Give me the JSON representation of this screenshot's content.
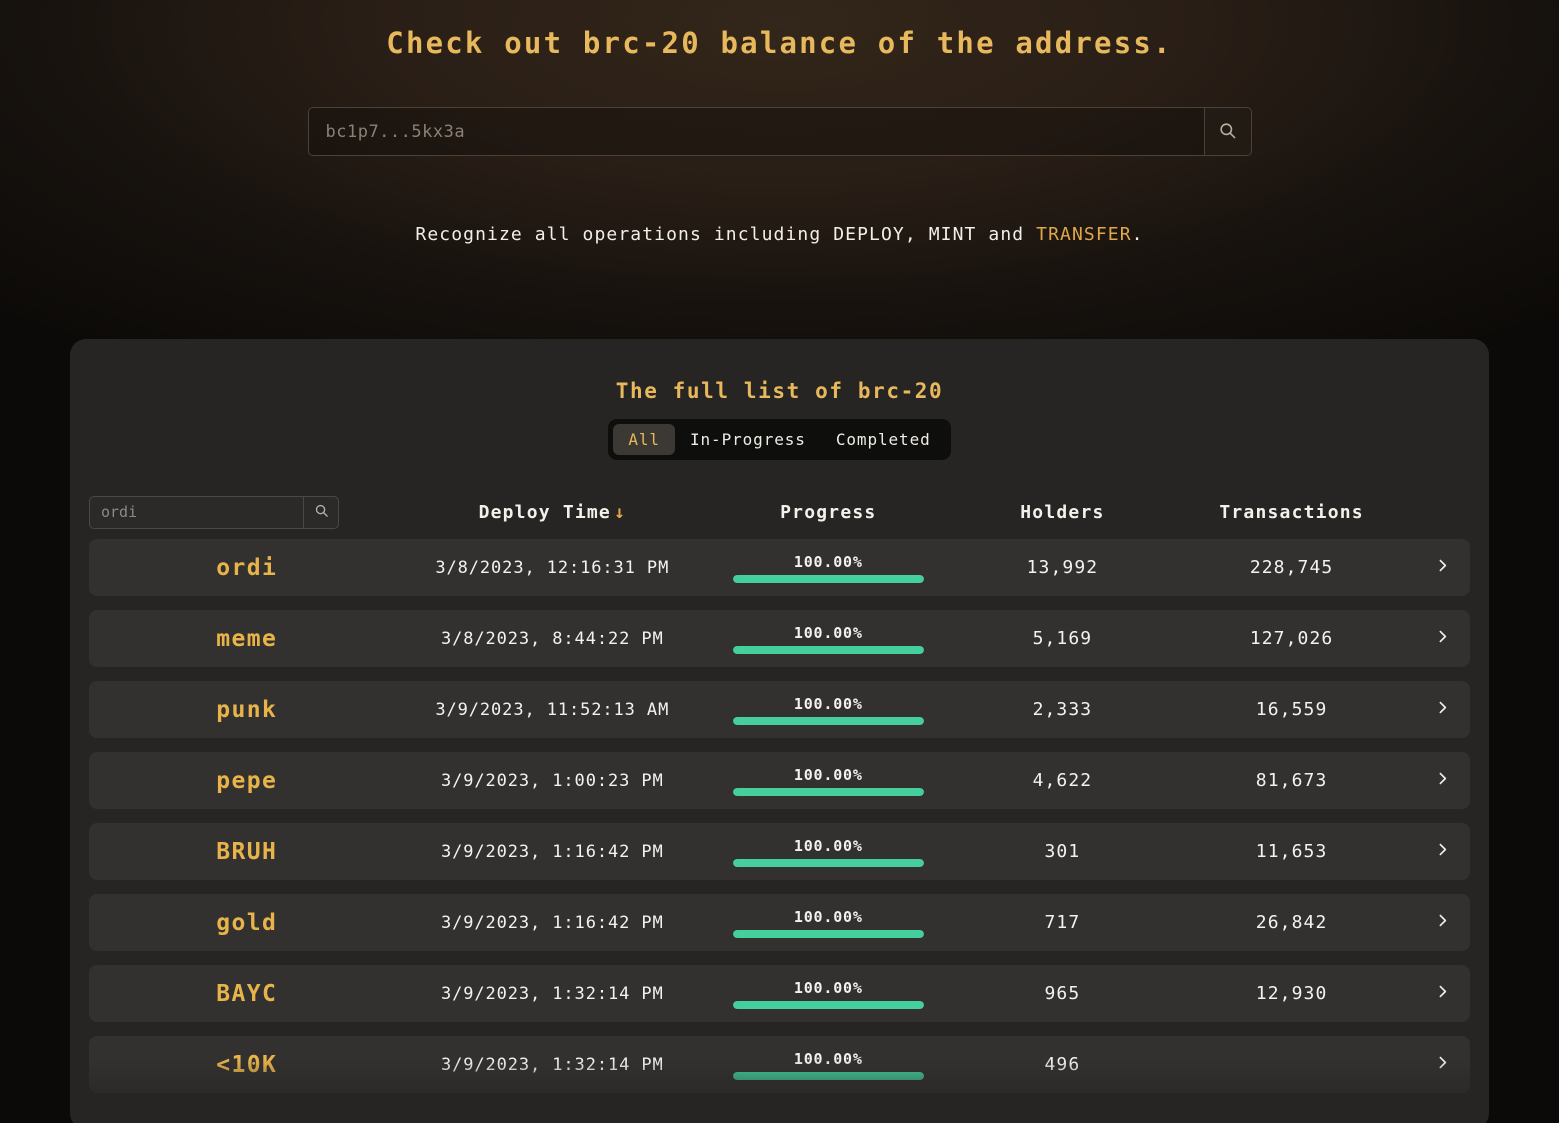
{
  "hero": {
    "title": "Check out brc-20 balance of the address.",
    "search": {
      "placeholder": "bc1p7...5kx3a",
      "value": "",
      "icon": "search-icon"
    },
    "subtitle_prefix": "Recognize all operations including DEPLOY, MINT and ",
    "subtitle_accent": "TRANSFER",
    "subtitle_suffix": "."
  },
  "panel": {
    "title": "The full list of brc-20",
    "tabs": [
      {
        "label": "All",
        "active": true
      },
      {
        "label": "In-Progress",
        "active": false
      },
      {
        "label": "Completed",
        "active": false
      }
    ],
    "filter_search": {
      "placeholder": "ordi",
      "value": "",
      "icon": "search-icon"
    },
    "columns": {
      "deploy_time": "Deploy Time",
      "deploy_time_sort": "↓",
      "progress": "Progress",
      "holders": "Holders",
      "transactions": "Transactions"
    },
    "rows": [
      {
        "token": "ordi",
        "deploy_time": "3/8/2023, 12:16:31 PM",
        "progress_label": "100.00%",
        "progress_pct": 100,
        "holders": "13,992",
        "transactions": "228,745",
        "chevron": "chevron-right-icon"
      },
      {
        "token": "meme",
        "deploy_time": "3/8/2023, 8:44:22 PM",
        "progress_label": "100.00%",
        "progress_pct": 100,
        "holders": "5,169",
        "transactions": "127,026",
        "chevron": "chevron-right-icon"
      },
      {
        "token": "punk",
        "deploy_time": "3/9/2023, 11:52:13 AM",
        "progress_label": "100.00%",
        "progress_pct": 100,
        "holders": "2,333",
        "transactions": "16,559",
        "chevron": "chevron-right-icon"
      },
      {
        "token": "pepe",
        "deploy_time": "3/9/2023, 1:00:23 PM",
        "progress_label": "100.00%",
        "progress_pct": 100,
        "holders": "4,622",
        "transactions": "81,673",
        "chevron": "chevron-right-icon"
      },
      {
        "token": "BRUH",
        "deploy_time": "3/9/2023, 1:16:42 PM",
        "progress_label": "100.00%",
        "progress_pct": 100,
        "holders": "301",
        "transactions": "11,653",
        "chevron": "chevron-right-icon"
      },
      {
        "token": "gold",
        "deploy_time": "3/9/2023, 1:16:42 PM",
        "progress_label": "100.00%",
        "progress_pct": 100,
        "holders": "717",
        "transactions": "26,842",
        "chevron": "chevron-right-icon"
      },
      {
        "token": "BAYC",
        "deploy_time": "3/9/2023, 1:32:14 PM",
        "progress_label": "100.00%",
        "progress_pct": 100,
        "holders": "965",
        "transactions": "12,930",
        "chevron": "chevron-right-icon"
      },
      {
        "token": "<10K",
        "deploy_time": "3/9/2023, 1:32:14 PM",
        "progress_label": "100.00%",
        "progress_pct": 100,
        "holders": "496",
        "transactions": "",
        "chevron": "chevron-right-icon"
      }
    ]
  },
  "colors": {
    "accent_gold": "#e8b85c",
    "token_gold": "#e8b44a",
    "progress_green": "#44cf9c",
    "panel_bg": "#262523",
    "row_bg": "#323130",
    "text": "#f4f2ee"
  }
}
